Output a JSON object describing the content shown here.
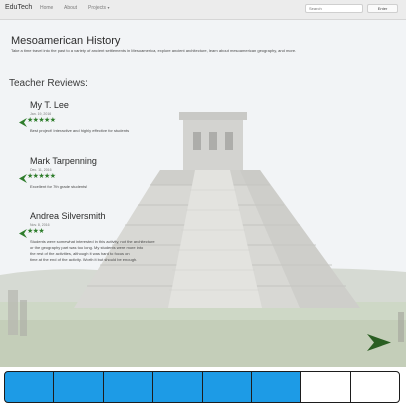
{
  "navbar": {
    "brand": "EduTech",
    "links": [
      "Home",
      "About"
    ],
    "dropdown_label": "Projects",
    "search_placeholder": "Search",
    "search_button": "Enter"
  },
  "hero": {
    "title": "Mesoamerican History",
    "subtitle": "Take a time travel into the past to a variety of ancient settlements in Mesoamerica, explore ancient architecture, learn about mesoamerican geography, and more.",
    "reviews_heading": "Teacher Reviews:",
    "reviews": [
      {
        "name": "My T. Lee",
        "date": "Jan. 19, 2016",
        "stars": "★★★★★",
        "text": [
          "Best project! Interactive and highly effective for students"
        ]
      },
      {
        "name": "Mark Tarpenning",
        "date": "Dec. 11, 2016",
        "stars": "★★★★★",
        "text": [
          "Excellent for 7th grade students!"
        ]
      },
      {
        "name": "Andrea Silversmith",
        "date": "Nov. 8, 2016",
        "stars": "★★★",
        "text": [
          "Students were somewhat interested in this activity, not the architecture",
          "or the geography part was too long. My students were more into",
          "the rest of the activities, although it was hard to focus on",
          "time at the end of the activity. Worth it but should be enough."
        ]
      }
    ]
  },
  "progress": {
    "total_segments": 8,
    "filled_segments": 6,
    "fill_color": "#1d9be6"
  }
}
